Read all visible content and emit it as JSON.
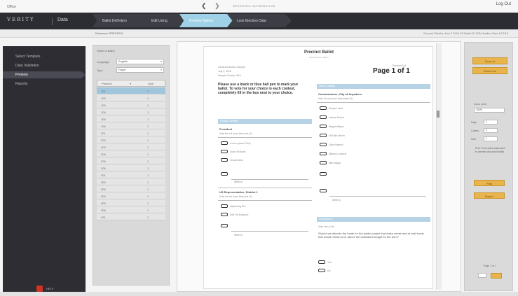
{
  "top": {
    "app_label": "Office",
    "logout": "Log Out",
    "nav_prev": "❮",
    "nav_next": "❯",
    "url": "RESERVED INFORMATION"
  },
  "header": {
    "logo": "VERITY",
    "title": "Data",
    "steps": [
      "Ballot Definition",
      "Edit Using",
      "Preview Ballots",
      "Lock Election Data"
    ],
    "active_step": 2
  },
  "subbar": {
    "reference": "Reference  PRESS001",
    "meta": "General Election  Nov 2 2016  V2    Ballot ID  1234    Auditor Date  12/7/16"
  },
  "nav": {
    "items": [
      "Select Template",
      "Data Validation",
      "Preview",
      "Reports"
    ],
    "active": 2,
    "footer_label": "HELP"
  },
  "precinct_panel": {
    "title": "Select a Ballot",
    "language_label": "Language",
    "language_value": "English",
    "type_label": "Type",
    "type_value": "Paper",
    "col1": "Precinct",
    "col2": "Split",
    "rows": [
      [
        "101",
        "1"
      ],
      [
        "102",
        "1"
      ],
      [
        "103",
        "1"
      ],
      [
        "104",
        "1"
      ],
      [
        "105",
        "1"
      ],
      [
        "106",
        "1"
      ],
      [
        "201",
        "1"
      ],
      [
        "202",
        "1"
      ],
      [
        "203",
        "1"
      ],
      [
        "204",
        "1"
      ],
      [
        "205",
        "1"
      ],
      [
        "206",
        "1"
      ],
      [
        "301",
        "1"
      ],
      [
        "302",
        "1"
      ],
      [
        "303",
        "1"
      ],
      [
        "304",
        "1"
      ],
      [
        "305",
        "1"
      ],
      [
        "306",
        "1"
      ],
      [
        "401",
        "1"
      ]
    ],
    "selected_row": 0
  },
  "ballot": {
    "title": "Precinct Ballot",
    "subtitle": "Precinct 101 / Split 1",
    "election": "General Election  Sample",
    "date": "July 4, 2016",
    "county": "Sample County, USA",
    "ballot_id": "Precinct 101",
    "page_of": "Page 1 of 1",
    "instructions": "Please use a black or blue ball pen to mark your ballot. To vote for your choice in each contest, completely fill in the box next to your choice.",
    "left_head": "County Contests",
    "left_contest": "President",
    "left_sub": "Vote for not more than one (1)",
    "left_options": [
      "Lorem Ipsum Party",
      "Dolor Sit Amet",
      "Consectetur"
    ],
    "left_writein": "Write-in",
    "left_contest2": "US Representative, District 1",
    "left_sub2": "Vote for not more than one (1)",
    "left_options2": [
      "Adipiscing Elit",
      "Sed Do Eiusmod"
    ],
    "left_writein2": "Write-in",
    "right_head": "State Contests",
    "right_contest": "Commissioner, City of Anywhere",
    "right_sub": "Vote for not more than three (3)",
    "right_options": [
      "Tempor Incid",
      "Labore Dolore",
      "Magna Aliqua",
      "Ut Enim Minim",
      "Quis Nostrud",
      "Ullamco Laboris",
      "Nisi Aliquip"
    ],
    "right_writein": "Write-in",
    "prop_head": "Proposition 1",
    "prop_sub": "Vote Yes or No",
    "prop_text": "Should we allocate the funds for the public project that make sense and at cost levels that would remain at or above the estimated budget for the term?",
    "prop_yes": "Yes",
    "prop_no": "No"
  },
  "right_panel": {
    "buttons": [
      "Zoom In",
      "Zoom Out"
    ],
    "zoom_label": "Zoom Level",
    "zoom_value": "100%",
    "page_label": "Page",
    "page_value": "1",
    "copies_label": "Copies",
    "copies_value": "1",
    "side_label": "Side",
    "side_value": "1",
    "note": "Print Proof adds watermark to preview and proof ballot",
    "print_btn": "Print",
    "export_btn": "Export",
    "pager": "Page 1 of 1"
  }
}
